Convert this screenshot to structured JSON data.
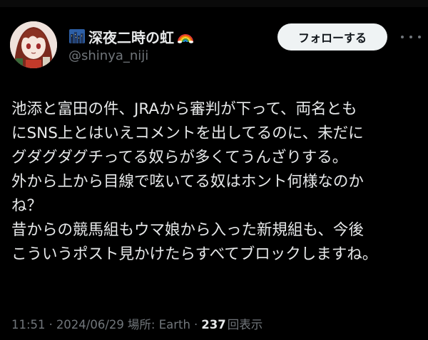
{
  "user": {
    "display_name": "深夜二時の虹",
    "handle": "@shinya_niji",
    "name_icon_before": "city-night-emoji-icon",
    "name_icon_after": "rainbow-emoji-icon",
    "avatar": "avatar-image"
  },
  "actions": {
    "follow_label": "フォローする",
    "more_icon": "more-options-icon"
  },
  "tweet": {
    "lines": [
      "池添と富田の件、JRAから審判が下って、両名とも",
      "にSNS上とはいえコメントを出してるのに、未だに",
      "グダグダグチってる奴らが多くてうんざりする。",
      "外から上から目線で呟いてる奴はホント何様なのか",
      "ね？",
      "昔からの競馬組もウマ娘から入った新規組も、今後",
      "こういうポスト見かけたらすべてブロックしますね。"
    ]
  },
  "meta": {
    "time": "11:51",
    "separator": "·",
    "date": "2024/06/29",
    "location": "場所: Earth",
    "views_count": "237",
    "views_label": "回表示"
  },
  "colors": {
    "background": "#000000",
    "text_primary": "#e7e9ea",
    "text_secondary": "#71767b",
    "follow_button_bg": "#eff3f4",
    "follow_button_text": "#0f1419"
  }
}
